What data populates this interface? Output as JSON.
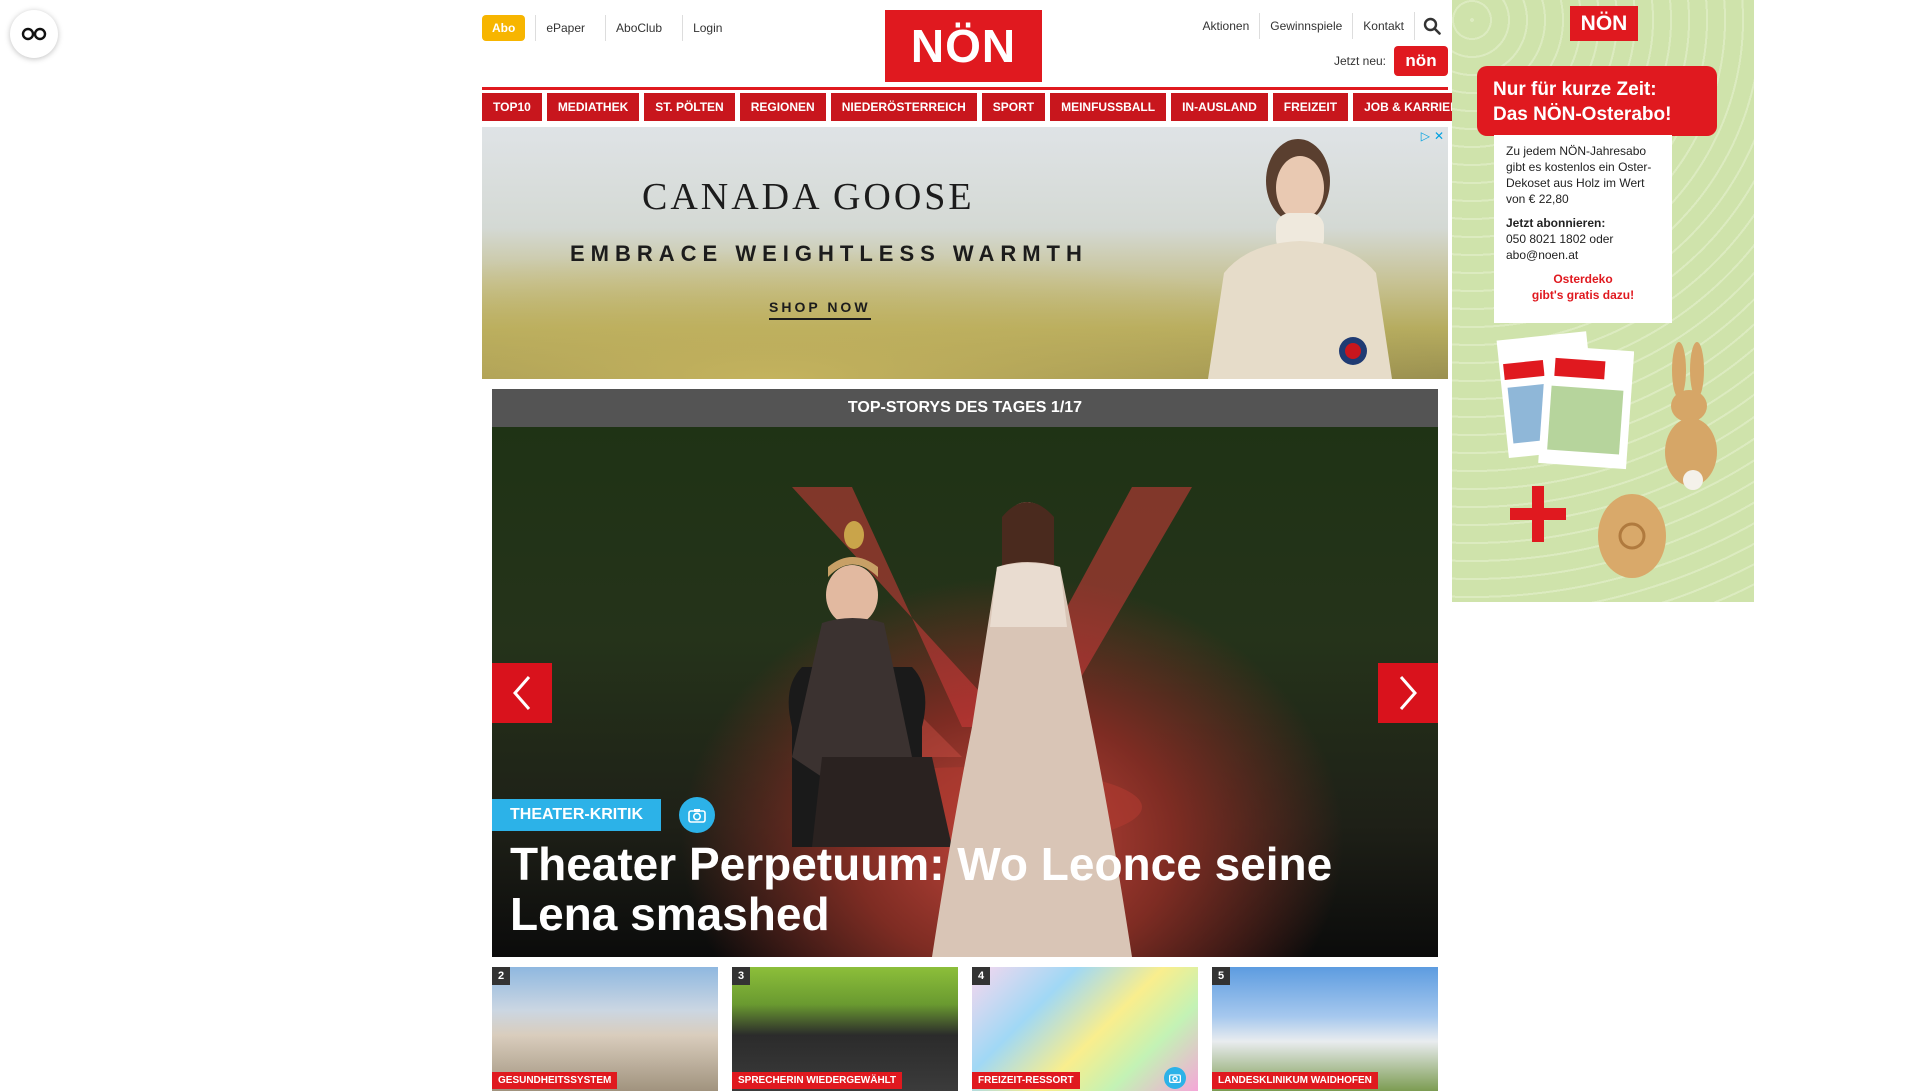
{
  "topnav": {
    "abo": "Abo",
    "links": [
      "ePaper",
      "AboClub",
      "Login"
    ]
  },
  "logo": "NÖN",
  "rightnav": {
    "links": [
      "Aktionen",
      "Gewinnspiele",
      "Kontakt"
    ],
    "jetzt_label": "Jetzt neu:",
    "jetzt_logo": "nön"
  },
  "categories": [
    "TOP10",
    "MEDIATHEK",
    "ST. PÖLTEN",
    "REGIONEN",
    "NIEDERÖSTERREICH",
    "SPORT",
    "MEINFUSSBALL",
    "IN-AUSLAND",
    "FREIZEIT",
    "JOB & KARRIERE"
  ],
  "ad": {
    "brand": "CANADA GOOSE",
    "tagline": "EMBRACE WEIGHTLESS WARMTH",
    "cta": "SHOP NOW"
  },
  "stories": {
    "header": "TOP-STORYS DES TAGES 1/17",
    "hero": {
      "tag": "THEATER-KRITIK",
      "headline": "Theater Perpetuum: Wo Leonce seine Lena smashed"
    },
    "thumbs": [
      {
        "num": "2",
        "label": "GESUNDHEITSSYSTEM"
      },
      {
        "num": "3",
        "label": "SPRECHERIN WIEDERGEWÄHLT"
      },
      {
        "num": "4",
        "label": "FREIZEIT-RESSORT"
      },
      {
        "num": "5",
        "label": "LANDESKLINIKUM WAIDHOFEN"
      }
    ]
  },
  "side": {
    "logo": "NÖN",
    "banner_line1": "Nur für kurze Zeit:",
    "banner_line2": "Das NÖN-Osterabo!",
    "body": "Zu jedem NÖN-Jahresabo gibt es kostenlos ein Oster-Dekoset aus Holz im Wert von € 22,80",
    "subscribe_title": "Jetzt abonnieren:",
    "subscribe_contact": "050 8021 1802 oder abo@noen.at",
    "red_line1": "Osterdeko",
    "red_line2": "gibt's gratis dazu!"
  }
}
